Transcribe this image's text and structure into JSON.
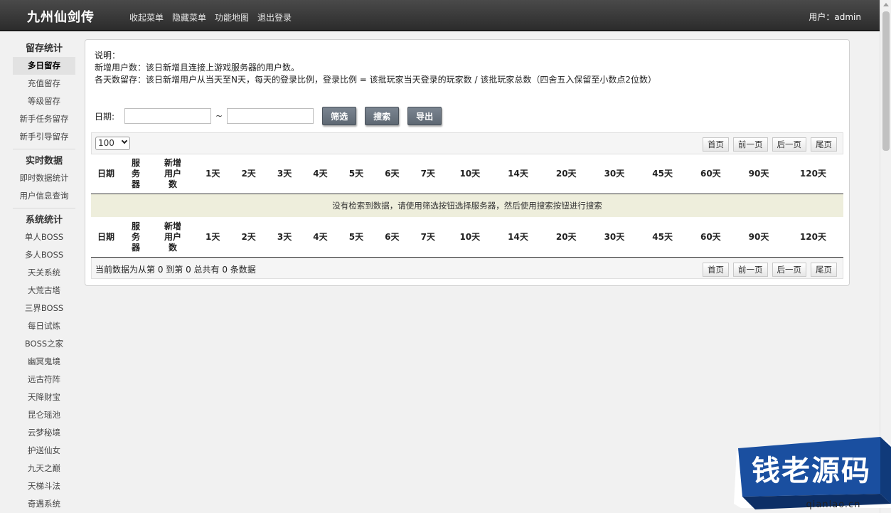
{
  "app": {
    "title": "九州仙剑传",
    "user_label": "用户：admin"
  },
  "topnav": [
    "收起菜单",
    "隐藏菜单",
    "功能地图",
    "退出登录"
  ],
  "sidebar": {
    "groups": [
      {
        "title": "留存统计",
        "items": [
          "多日留存",
          "充值留存",
          "等级留存",
          "新手任务留存",
          "新手引导留存"
        ],
        "active": 0
      },
      {
        "title": "实时数据",
        "items": [
          "即时数据统计",
          "用户信息查询"
        ]
      },
      {
        "title": "系统统计",
        "items": [
          "单人BOSS",
          "多人BOSS",
          "天关系统",
          "大荒古塔",
          "三界BOSS",
          "每日试炼",
          "BOSS之家",
          "幽冥鬼境",
          "远古符阵",
          "天降财宝",
          "昆仑瑶池",
          "云梦秘境",
          "护送仙女",
          "九天之巅",
          "天梯斗法",
          "奇遇系统"
        ]
      }
    ]
  },
  "description": {
    "line1": "说明：",
    "line2": "新增用户数：该日新增且连接上游戏服务器的用户数。",
    "line3": "各天数留存：该日新增用户从当天至N天，每天的登录比例，登录比例 = 该批玩家当天登录的玩家数 / 该批玩家总数（四舍五入保留至小数点2位数）"
  },
  "filter": {
    "date_label": "日期:",
    "start_value": "",
    "end_value": "",
    "separator": "~",
    "buttons": [
      "筛选",
      "搜索",
      "导出"
    ]
  },
  "table": {
    "page_size": "100",
    "pager": [
      "首页",
      "前一页",
      "后一页",
      "尾页"
    ],
    "headers": [
      "日期",
      "服务器",
      "新增用户数",
      "1天",
      "2天",
      "3天",
      "4天",
      "5天",
      "6天",
      "7天",
      "10天",
      "14天",
      "20天",
      "30天",
      "45天",
      "60天",
      "90天",
      "120天"
    ],
    "empty_message": "没有检索到数据，请使用筛选按钮选择服务器，然后使用搜索按钮进行搜索",
    "status": "当前数据为从第 0 到第 0 总共有 0 条数据"
  },
  "watermark": {
    "text": "钱老源码",
    "url": "qianlao.cn"
  },
  "colors": {
    "topbar": "#3a3a3a",
    "button": "#6b7580",
    "empty_row": "#eeeedc",
    "watermark": "#1a4fa0"
  }
}
